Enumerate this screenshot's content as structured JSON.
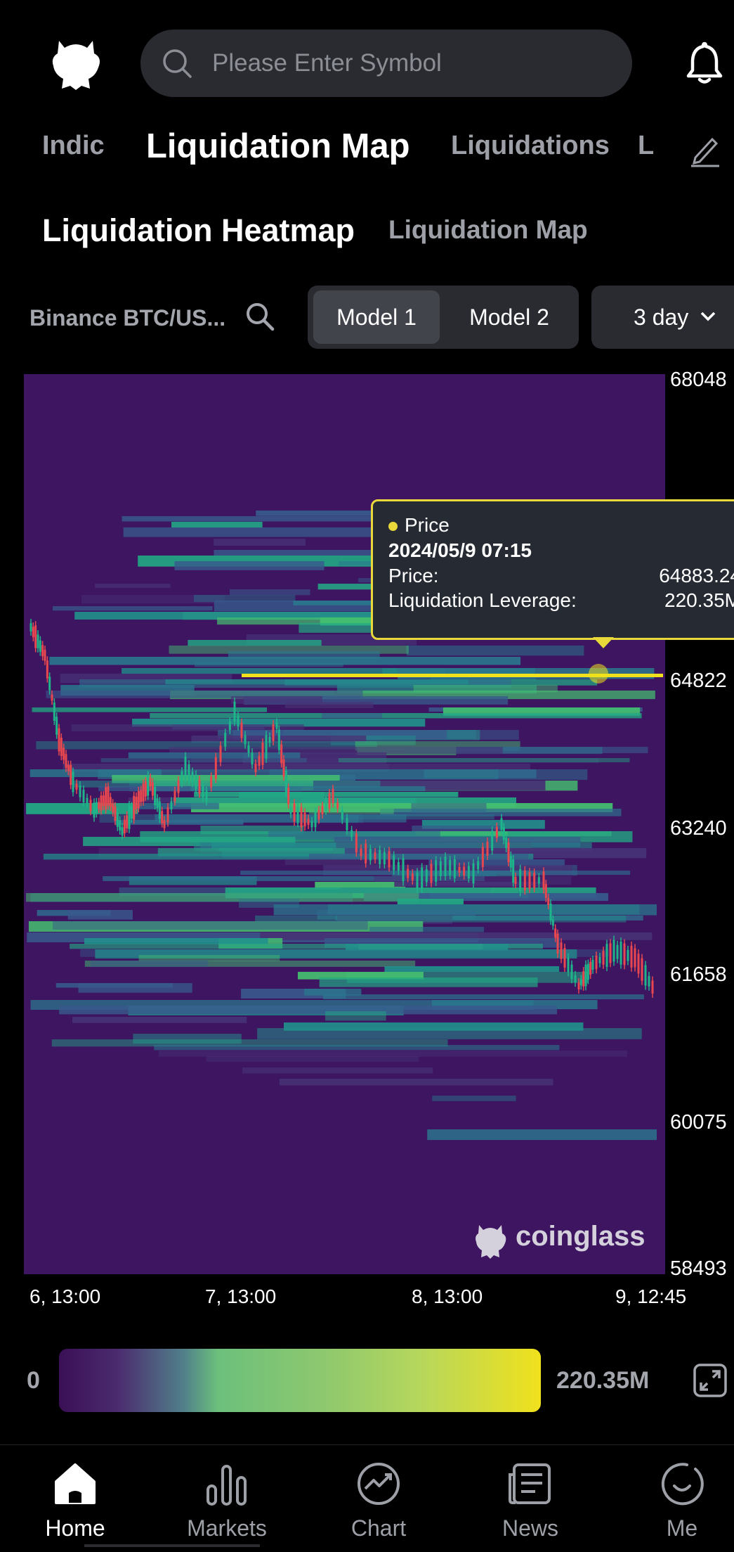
{
  "search": {
    "placeholder": "Please Enter Symbol"
  },
  "top_tabs": [
    {
      "label": "Indic"
    },
    {
      "label": "Liquidation Map"
    },
    {
      "label": "Liquidations"
    },
    {
      "label": "L"
    }
  ],
  "sub_tabs": [
    {
      "label": "Liquidation Heatmap"
    },
    {
      "label": "Liquidation Map"
    }
  ],
  "controls": {
    "pair": "Binance BTC/US...",
    "models": [
      "Model 1",
      "Model 2"
    ],
    "range": "3 day"
  },
  "tooltip": {
    "series": "Price",
    "time": "2024/05/9 07:15",
    "price_label": "Price:",
    "price_value": "64883.24",
    "leverage_label": "Liquidation Leverage:",
    "leverage_value": "220.35M"
  },
  "chart_data": {
    "type": "heatmap",
    "y_ticks": [
      "68048",
      "64822",
      "63240",
      "61658",
      "60075",
      "58493"
    ],
    "x_ticks": [
      "6, 13:00",
      "7, 13:00",
      "8, 13:00",
      "9, 12:45"
    ],
    "ylim": [
      58493,
      68048
    ],
    "colorscale_range": [
      "0",
      "220.35M"
    ],
    "watermark": "coinglass"
  },
  "colors": {
    "heat_low": "#3d1560",
    "heat_mid": "#22a884",
    "heat_high": "#f0e11c",
    "candle_up": "#1fb58a",
    "candle_down": "#e8474f",
    "accent": "#e8d83a"
  },
  "legend": {
    "min": "0",
    "max": "220.35M"
  },
  "nav": [
    {
      "label": "Home",
      "icon": "home-icon"
    },
    {
      "label": "Markets",
      "icon": "markets-icon"
    },
    {
      "label": "Chart",
      "icon": "chart-icon"
    },
    {
      "label": "News",
      "icon": "news-icon"
    },
    {
      "label": "Me",
      "icon": "me-icon"
    }
  ]
}
